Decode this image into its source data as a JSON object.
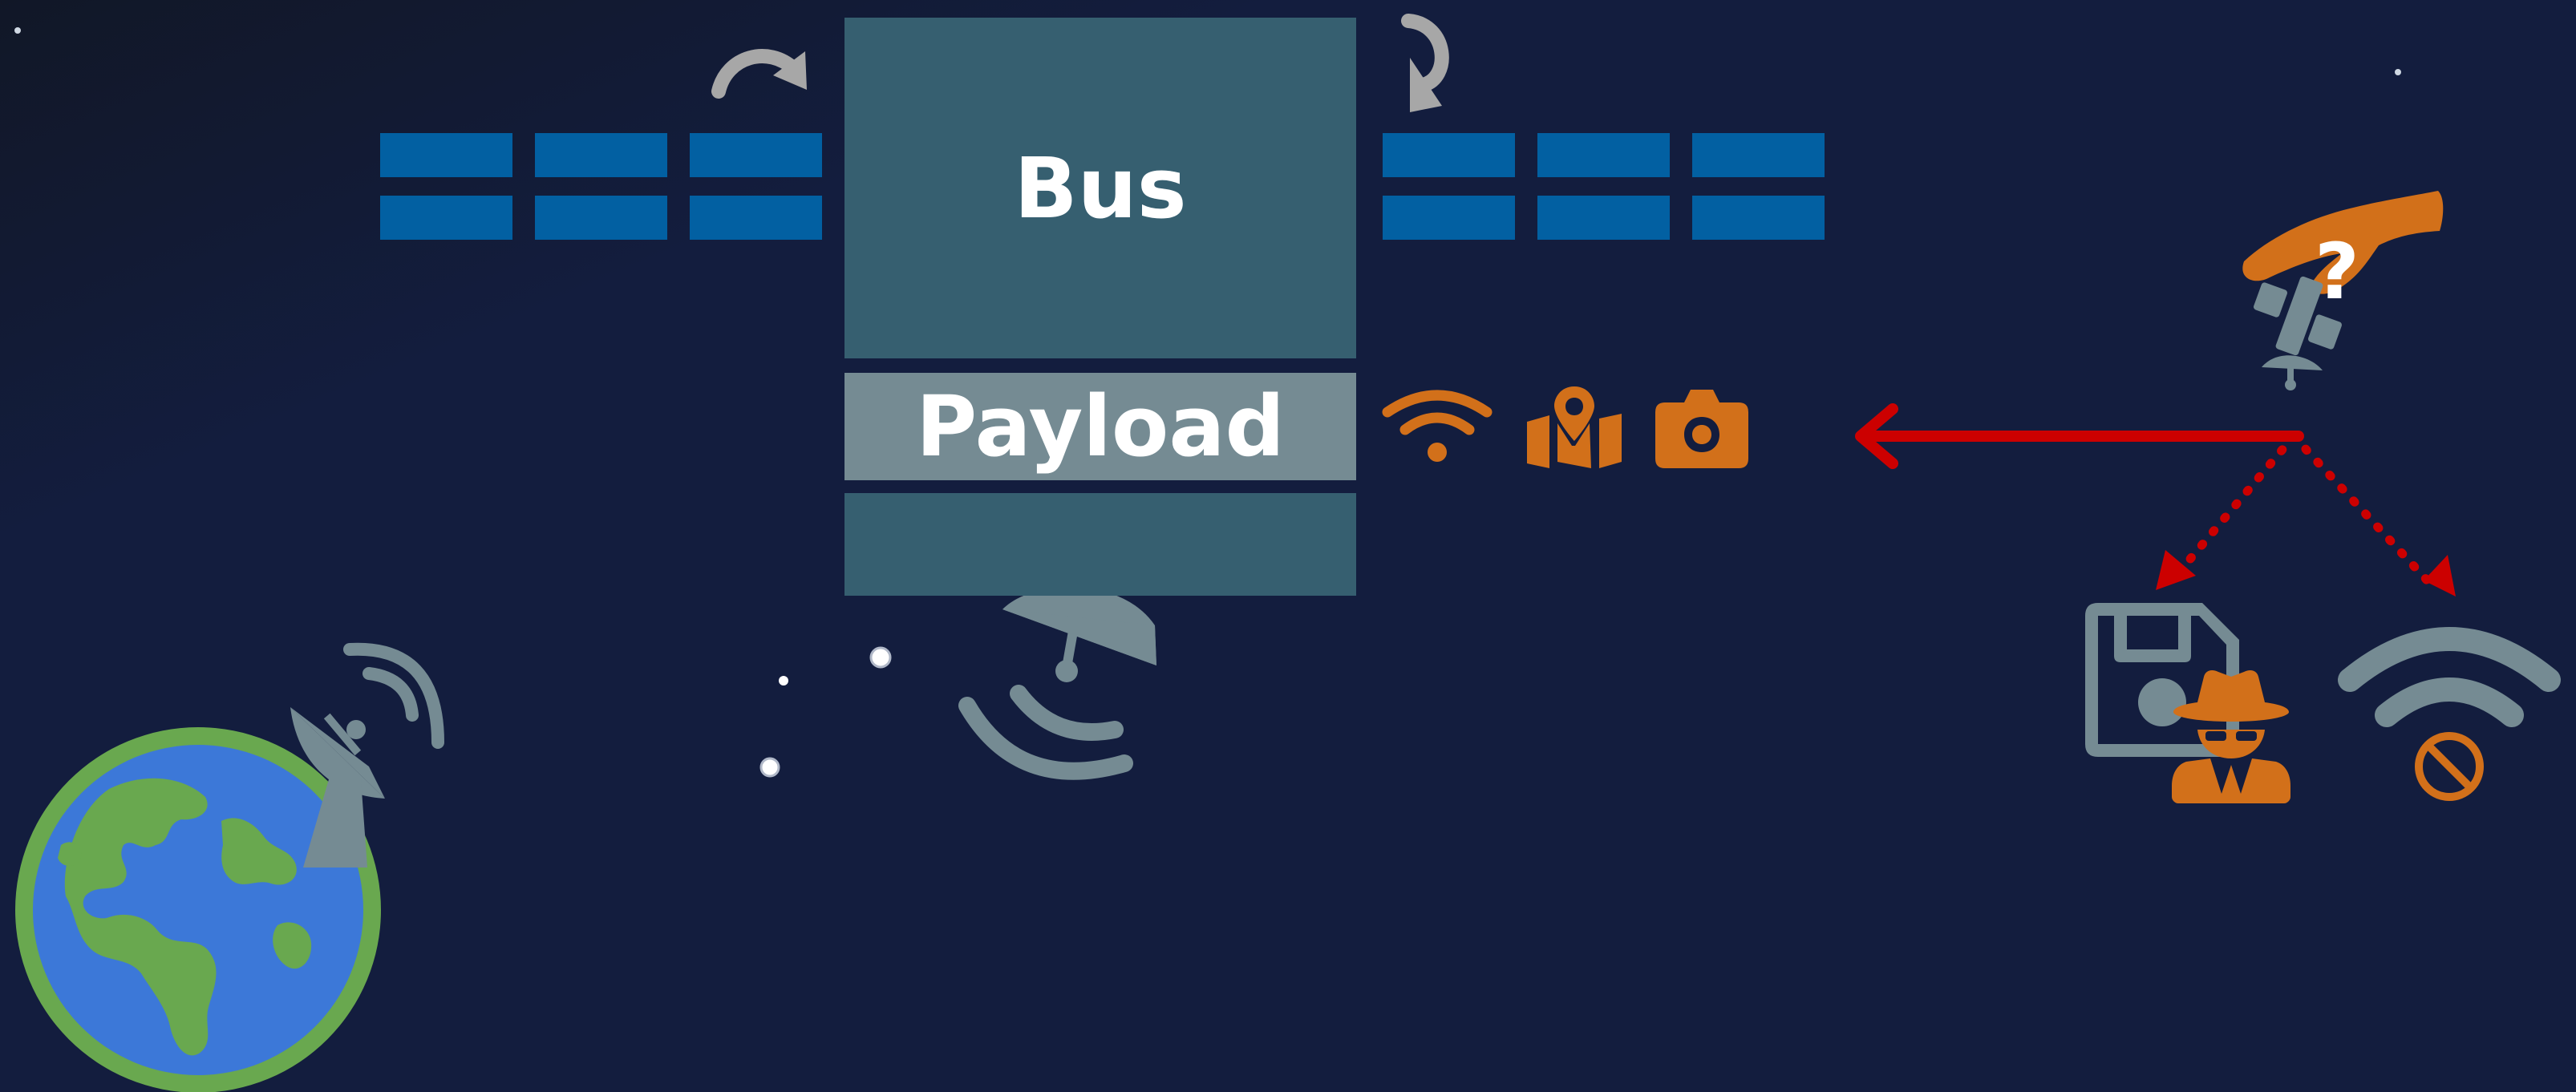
{
  "colors": {
    "background_top_left": "#111727",
    "background": "#131d3e",
    "bus": "#365f70",
    "payload": "#758b93",
    "solar_panel": "#0260a2",
    "orange_accent": "#d2701a",
    "gray_icon": "#758b93",
    "light_gray_arrow": "#a7a7a7",
    "red_arrow": "#cc0000",
    "earth_land": "#69a84f",
    "earth_ocean": "#3c78d8",
    "label_text": "#ffffff"
  },
  "satellite": {
    "bus_label": "Bus",
    "payload_label": "Payload",
    "payload_capabilities": [
      "wifi-icon",
      "map-icon",
      "camera-icon"
    ]
  },
  "ground": {
    "earth": "globe-icon",
    "ground_station": "satellite-dish-icon"
  },
  "threat": {
    "grabbing_hand": "hand-icon",
    "question_mark": "?",
    "targets": [
      "floppy-disk-icon",
      "spy-icon",
      "wifi-icon",
      "ban-icon"
    ]
  }
}
